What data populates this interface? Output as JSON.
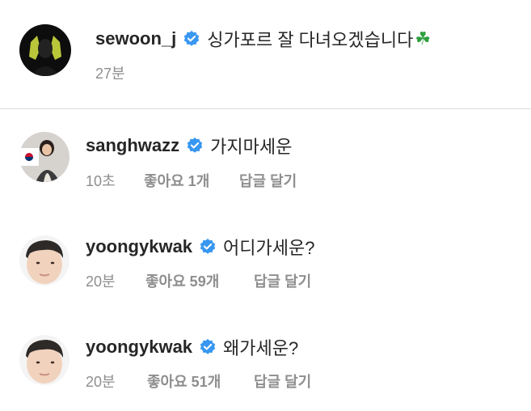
{
  "caption": {
    "username": "sewoon_j",
    "text": "싱가포르 잘 다녀오겠습니다",
    "emoji": "☘",
    "time": "27분"
  },
  "comments": [
    {
      "username": "sanghwazz",
      "text": "가지마세운",
      "time": "10초",
      "likes": "좋아요 1개",
      "reply": "답글 달기"
    },
    {
      "username": "yoongykwak",
      "text": "어디가세운?",
      "time": "20분",
      "likes": "좋아요 59개",
      "reply": "답글 달기"
    },
    {
      "username": "yoongykwak",
      "text": "왜가세운?",
      "time": "20분",
      "likes": "좋아요 51개",
      "reply": "답글 달기"
    }
  ],
  "colors": {
    "verified_badge": "#3897f0",
    "meta_text": "#8e8e8e",
    "divider": "#dbdbdb"
  }
}
